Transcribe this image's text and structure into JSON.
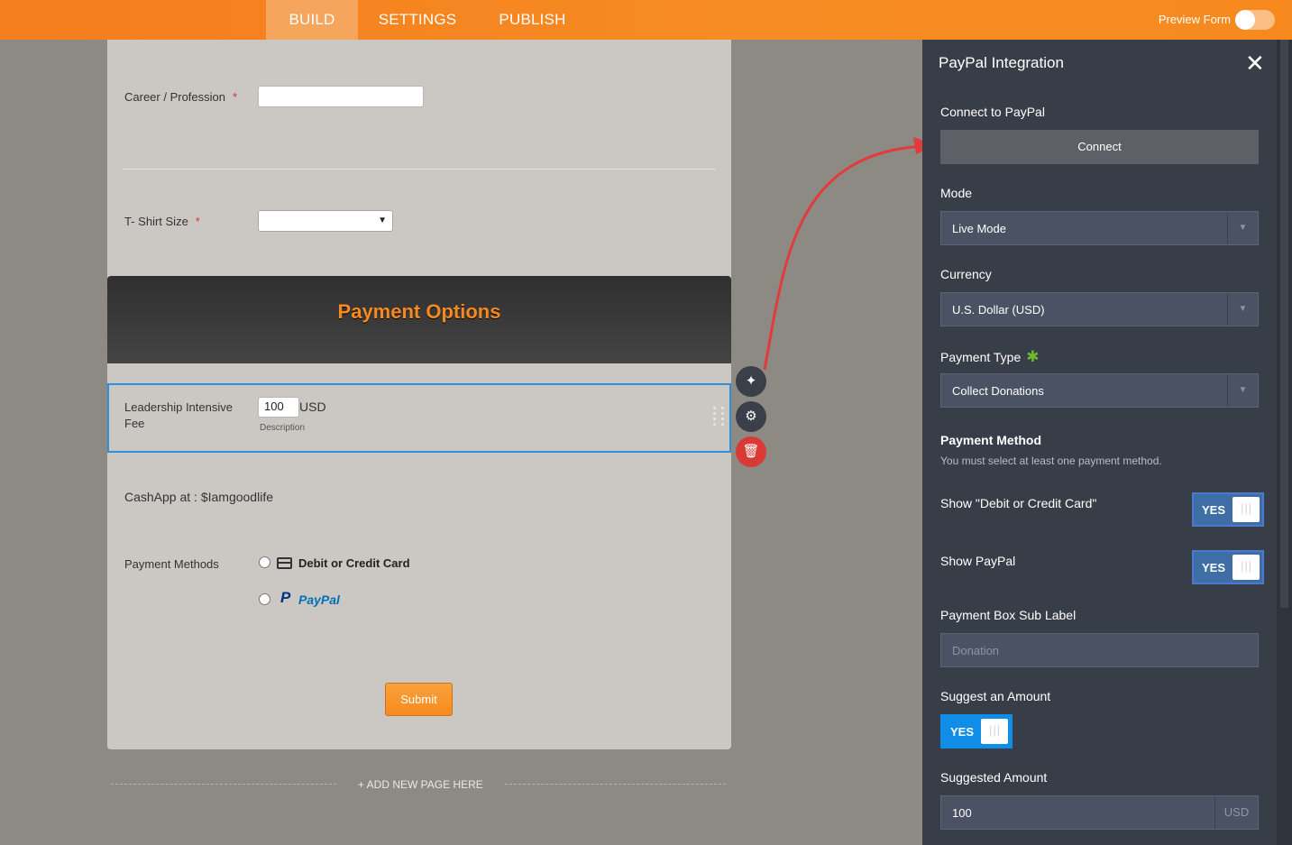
{
  "topbar": {
    "tabs": [
      {
        "label": "BUILD",
        "active": true
      },
      {
        "label": "SETTINGS",
        "active": false
      },
      {
        "label": "PUBLISH",
        "active": false
      }
    ],
    "preview_label": "Preview Form",
    "preview_enabled": false
  },
  "form": {
    "career_label": "Career / Profession",
    "required_mark": "*",
    "tshirt_label": "T- Shirt Size",
    "payment_header": "Payment Options",
    "fee_label": "Leadership Intensive Fee",
    "fee_amount": "100",
    "fee_currency": "USD",
    "fee_description": "Description",
    "cashapp_text": "CashApp at : $Iamgoodlife",
    "payment_methods_label": "Payment Methods",
    "methods": [
      {
        "label": "Debit or Credit Card",
        "icon": "credit-card-icon"
      },
      {
        "label": "PayPal",
        "icon": "paypal-logo"
      }
    ],
    "submit_label": "Submit",
    "add_page_label": "+ ADD NEW PAGE HERE"
  },
  "tools": {
    "wand_icon": "✦",
    "gear_icon": "⚙",
    "trash_icon": "🗑"
  },
  "panel": {
    "title": "PayPal Integration",
    "close_icon": "✕",
    "connect_label": "Connect to PayPal",
    "connect_button": "Connect",
    "mode_label": "Mode",
    "mode_value": "Live Mode",
    "currency_label": "Currency",
    "currency_value": "U.S. Dollar (USD)",
    "payment_type_label": "Payment Type",
    "payment_type_value": "Collect Donations",
    "payment_method_heading": "Payment Method",
    "payment_method_note": "You must select at least one payment method.",
    "show_card_label": "Show \"Debit or Credit Card\"",
    "show_card_value": "YES",
    "show_paypal_label": "Show PayPal",
    "show_paypal_value": "YES",
    "sub_label_label": "Payment Box Sub Label",
    "sub_label_placeholder": "Donation",
    "suggest_label": "Suggest an Amount",
    "suggest_value": "YES",
    "suggested_amount_label": "Suggested Amount",
    "suggested_amount_value": "100",
    "suggested_amount_unit": "USD"
  },
  "colors": {
    "topbar": "#f7891e",
    "panel": "#383e48",
    "selected_border": "#2f8fd8",
    "annotation_arrow": "#e23b3b"
  }
}
